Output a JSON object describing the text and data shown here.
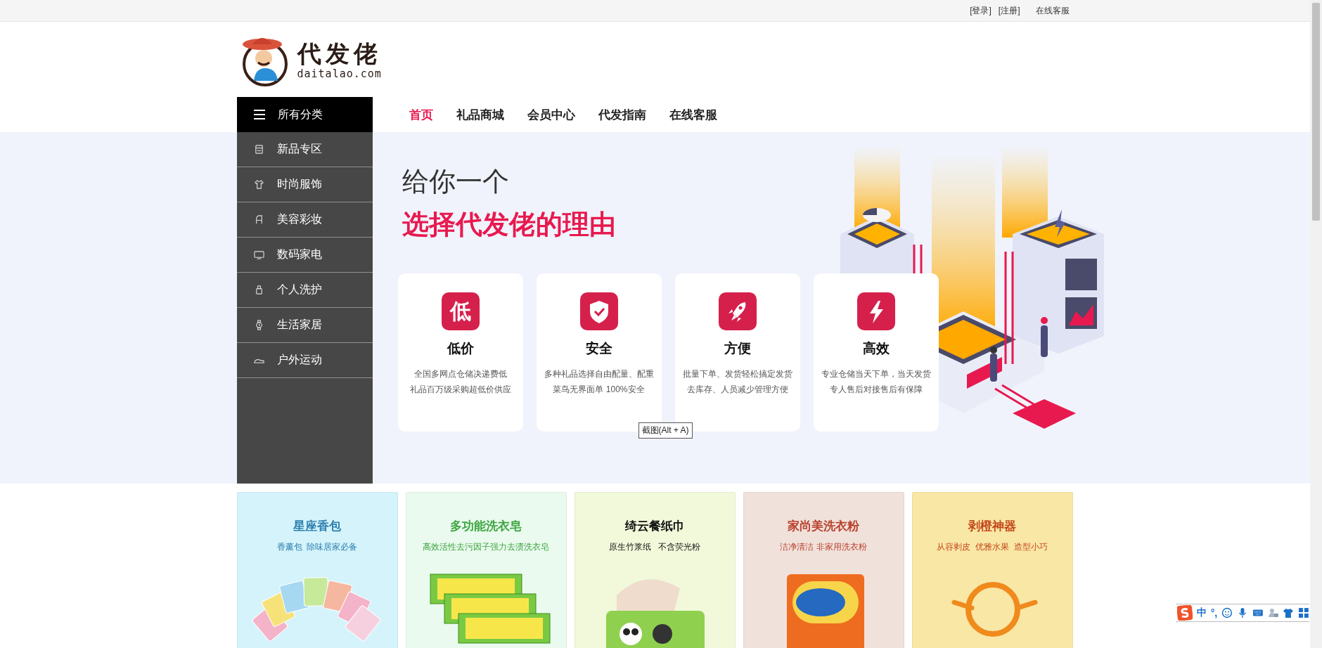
{
  "top_bar": {
    "links": [
      "[登录]",
      "[注册]",
      "在线客服"
    ]
  },
  "logo": {
    "name": "代发佬",
    "domain": "daitalao.com"
  },
  "category_menu": {
    "title": "所有分类",
    "items": [
      "新品专区",
      "时尚服饰",
      "美容彩妆",
      "数码家电",
      "个人洗护",
      "生活家居",
      "户外运动"
    ]
  },
  "nav": [
    {
      "label": "首页",
      "selected": true
    },
    {
      "label": "礼品商城",
      "selected": false
    },
    {
      "label": "会员中心",
      "selected": false
    },
    {
      "label": "代发指南",
      "selected": false
    },
    {
      "label": "在线客服",
      "selected": false
    }
  ],
  "hero": {
    "line_1": "给你一个",
    "line_2": "选择代发佬的理由"
  },
  "features": [
    {
      "icon_char": "低",
      "title": "低价",
      "description": [
        "全国多网点仓储决递费低",
        "礼品百万级采购超低价供应"
      ]
    },
    {
      "title": "安全",
      "description": [
        "多种礼品选择自由配量、配重",
        "菜鸟无界面单 100%安全"
      ]
    },
    {
      "title": "方便",
      "description": [
        "批量下单、发货轻松搞定发货",
        "去库存、人员减少管理方便"
      ]
    },
    {
      "title": "高效",
      "description": [
        "专业仓储当天下单，当天发货",
        "专人售后对接售后有保障"
      ]
    }
  ],
  "tooltip": "截图(Alt + A)",
  "products": [
    {
      "title": "星座香包",
      "subtitle": "香薰包  除味居家必备",
      "color": "#2b7fae"
    },
    {
      "title": "多功能洗衣皂",
      "subtitle": "高效活性去污因子强力去渍洗衣皂",
      "color": "#3ba53f"
    },
    {
      "title": "绮云餐纸巾",
      "subtitle": "原生竹浆纸   不含荧光粉",
      "color": "#111111"
    },
    {
      "title": "家尚美洗衣粉",
      "subtitle": "洁净清洁 非家用洗衣粉",
      "color": "#b8402c"
    },
    {
      "title": "剥橙神器",
      "subtitle": "从容剥皮  优雅水果  造型小巧",
      "color": "#c4461a"
    }
  ],
  "ime_toolbar": {
    "mode": "中",
    "punctuation": "°,"
  }
}
